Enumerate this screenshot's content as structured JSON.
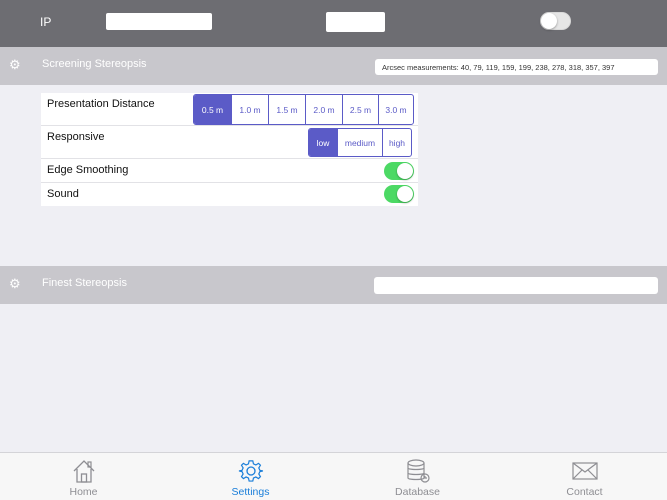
{
  "topbar": {
    "ip_label": "IP",
    "ip_value": "",
    "port_value": "",
    "toggle_on": false
  },
  "screening": {
    "title": "Screening Stereopsis",
    "icon": "gear-icon",
    "arcsec_text": "Arcsec measurements: 40, 79, 119, 159, 199, 238, 278, 318, 357, 397",
    "rows": {
      "distance": {
        "label": "Presentation Distance",
        "options": [
          "0.5 m",
          "1.0 m",
          "1.5 m",
          "2.0 m",
          "2.5 m",
          "3.0 m"
        ],
        "selected": "0.5 m"
      },
      "responsive": {
        "label": "Responsive",
        "options": [
          "low",
          "medium",
          "high"
        ],
        "selected": "low"
      },
      "edge_smoothing": {
        "label": "Edge Smoothing",
        "on": true
      },
      "sound": {
        "label": "Sound",
        "on": true
      }
    }
  },
  "finest": {
    "title": "Finest Stereopsis",
    "icon": "gear-icon",
    "value": ""
  },
  "tabs": [
    {
      "label": "Home",
      "icon": "home-icon",
      "active": false
    },
    {
      "label": "Settings",
      "icon": "gear-icon",
      "active": true
    },
    {
      "label": "Database",
      "icon": "database-icon",
      "active": false
    },
    {
      "label": "Contact",
      "icon": "envelope-icon",
      "active": false
    }
  ],
  "colors": {
    "accent": "#5b5bc7",
    "switch_on": "#4cd964",
    "tab_active": "#1a7ed9",
    "topbar": "#6d6d72",
    "section_header": "#c8c7cc"
  }
}
